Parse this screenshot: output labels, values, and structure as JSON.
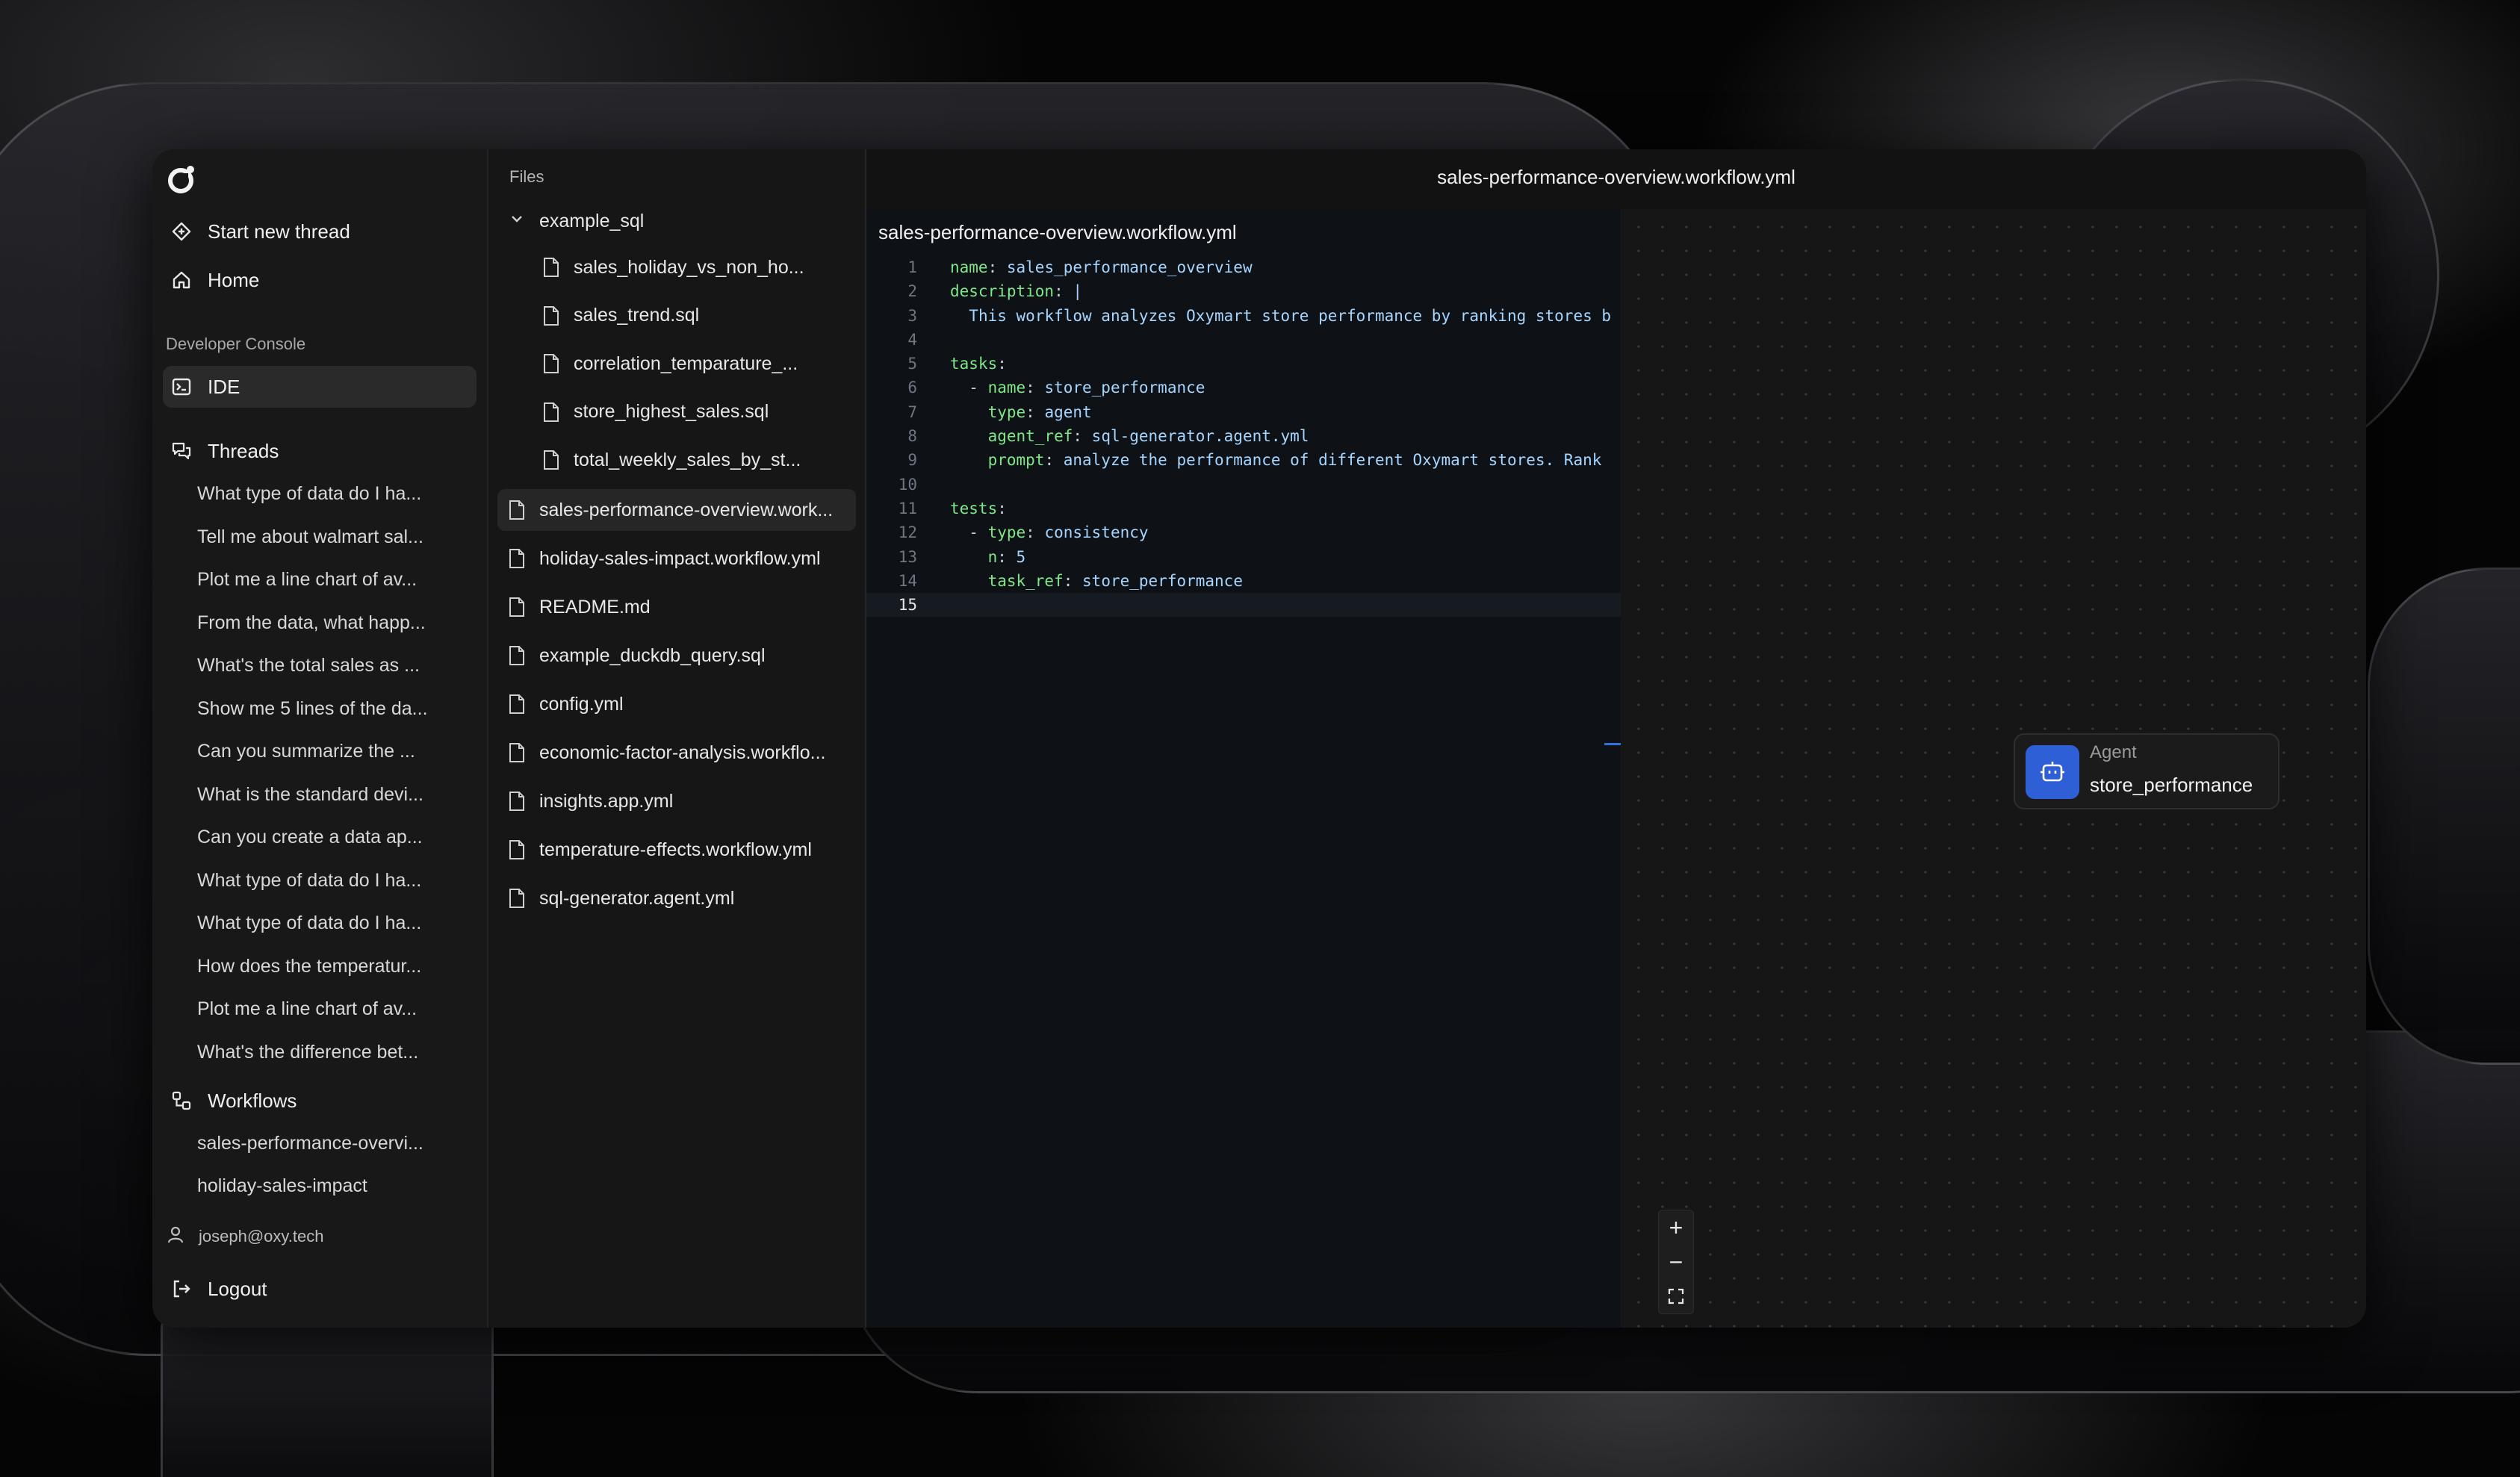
{
  "sidebar": {
    "start_new_thread": "Start new thread",
    "home": "Home",
    "developer_console_label": "Developer Console",
    "ide": "IDE",
    "threads_label": "Threads",
    "threads": [
      "What type of data do I ha...",
      "Tell me about walmart sal...",
      "Plot me a line chart of av...",
      "From the data, what happ...",
      "What's the total sales as ...",
      "Show me 5 lines of the da...",
      "Can you summarize the ...",
      "What is the standard devi...",
      "Can you create a data ap...",
      "What type of data do I ha...",
      "What type of data do I ha...",
      "How does the temperatur...",
      "Plot me a line chart of av...",
      "What's the difference bet..."
    ],
    "workflows_label": "Workflows",
    "workflows": [
      "sales-performance-overvi...",
      "holiday-sales-impact"
    ],
    "user_email": "joseph@oxy.tech",
    "logout": "Logout"
  },
  "files": {
    "title": "Files",
    "folder": "example_sql",
    "folder_children": [
      "sales_holiday_vs_non_ho...",
      "sales_trend.sql",
      "correlation_temparature_...",
      "store_highest_sales.sql",
      "total_weekly_sales_by_st..."
    ],
    "root_files": [
      "sales-performance-overview.work...",
      "holiday-sales-impact.workflow.yml",
      "README.md",
      "example_duckdb_query.sql",
      "config.yml",
      "economic-factor-analysis.workflo...",
      "insights.app.yml",
      "temperature-effects.workflow.yml",
      "sql-generator.agent.yml"
    ]
  },
  "main": {
    "title": "sales-performance-overview.workflow.yml",
    "editor_filename": "sales-performance-overview.workflow.yml",
    "current_line": 15,
    "code_lines": [
      {
        "n": "1",
        "indent": "",
        "key": "name",
        "sep": ": ",
        "val": "sales_performance_overview"
      },
      {
        "n": "2",
        "indent": "",
        "key": "description",
        "sep": ": ",
        "val": "|"
      },
      {
        "n": "3",
        "indent": "  ",
        "key": "",
        "sep": "",
        "val": "This workflow analyzes Oxymart store performance by ranking stores b"
      },
      {
        "n": "4",
        "indent": "",
        "key": "",
        "sep": "",
        "val": ""
      },
      {
        "n": "5",
        "indent": "",
        "key": "tasks",
        "sep": ":",
        "val": ""
      },
      {
        "n": "6",
        "indent": "  - ",
        "key": "name",
        "sep": ": ",
        "val": "store_performance"
      },
      {
        "n": "7",
        "indent": "    ",
        "key": "type",
        "sep": ": ",
        "val": "agent"
      },
      {
        "n": "8",
        "indent": "    ",
        "key": "agent_ref",
        "sep": ": ",
        "val": "sql-generator.agent.yml"
      },
      {
        "n": "9",
        "indent": "    ",
        "key": "prompt",
        "sep": ": ",
        "val": "analyze the performance of different Oxymart stores. Rank"
      },
      {
        "n": "10",
        "indent": "",
        "key": "",
        "sep": "",
        "val": ""
      },
      {
        "n": "11",
        "indent": "",
        "key": "tests",
        "sep": ":",
        "val": ""
      },
      {
        "n": "12",
        "indent": "  - ",
        "key": "type",
        "sep": ": ",
        "val": "consistency"
      },
      {
        "n": "13",
        "indent": "    ",
        "key": "n",
        "sep": ": ",
        "val": "5"
      },
      {
        "n": "14",
        "indent": "    ",
        "key": "task_ref",
        "sep": ": ",
        "val": "store_performance"
      },
      {
        "n": "15",
        "indent": "",
        "key": "",
        "sep": "",
        "val": ""
      }
    ],
    "node": {
      "type": "Agent",
      "name": "store_performance"
    },
    "zoom": {
      "zoom_in": "+",
      "zoom_out": "−"
    }
  },
  "colors": {
    "accent": "#2f5fd6",
    "yaml_key": "#7ee787",
    "yaml_value": "#a5d6ff"
  }
}
